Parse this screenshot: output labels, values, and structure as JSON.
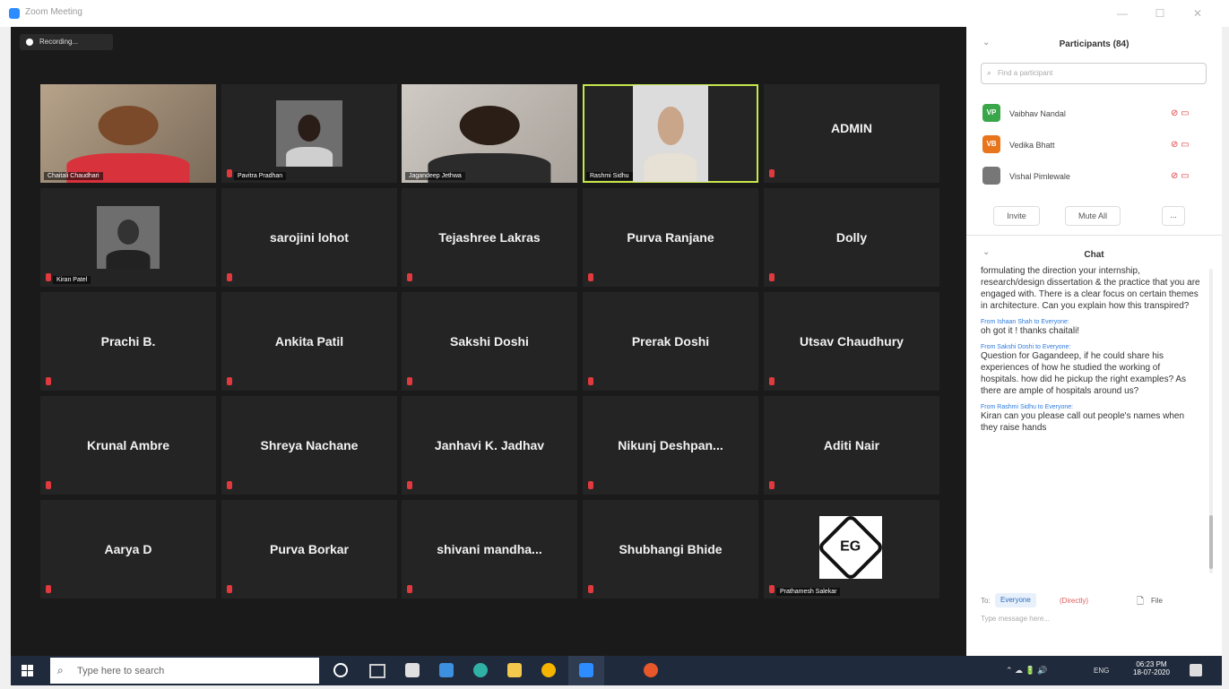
{
  "window": {
    "title": "Zoom Meeting",
    "minimize": "—",
    "maximize": "☐",
    "close": "✕"
  },
  "recording": {
    "label": "Recording..."
  },
  "tiles": [
    {
      "type": "video",
      "name": "Chaitali Chaudhari",
      "active": false
    },
    {
      "type": "video",
      "name": "Pavitra Pradhan",
      "active": false
    },
    {
      "type": "video",
      "name": "Jagandeep Jethwa",
      "active": false
    },
    {
      "type": "video",
      "name": "Rashmi Sidhu",
      "active": true
    },
    {
      "type": "name",
      "name": "ADMIN"
    },
    {
      "type": "video",
      "name": "Kiran Patel",
      "active": false
    },
    {
      "type": "name",
      "name": "sarojini lohot"
    },
    {
      "type": "name",
      "name": "Tejashree Lakras"
    },
    {
      "type": "name",
      "name": "Purva Ranjane"
    },
    {
      "type": "name",
      "name": "Dolly"
    },
    {
      "type": "name",
      "name": "Prachi B."
    },
    {
      "type": "name",
      "name": "Ankita Patil"
    },
    {
      "type": "name",
      "name": "Sakshi Doshi"
    },
    {
      "type": "name",
      "name": "Prerak Doshi"
    },
    {
      "type": "name",
      "name": "Utsav Chaudhury"
    },
    {
      "type": "name",
      "name": "Krunal Ambre"
    },
    {
      "type": "name",
      "name": "Shreya Nachane"
    },
    {
      "type": "name",
      "name": "Janhavi K. Jadhav"
    },
    {
      "type": "name",
      "name": "Nikunj  Deshpan..."
    },
    {
      "type": "name",
      "name": "Aditi Nair"
    },
    {
      "type": "name",
      "name": "Aarya D"
    },
    {
      "type": "name",
      "name": "Purva Borkar"
    },
    {
      "type": "name",
      "name": "shivani  mandha..."
    },
    {
      "type": "name",
      "name": "Shubhangi Bhide"
    },
    {
      "type": "logo",
      "name": "Prathamesh Salekar",
      "logo_text": "EG"
    }
  ],
  "participants": {
    "header": "Participants (84)",
    "search_placeholder": "Find a participant",
    "items": [
      {
        "initials": "VP",
        "name": "Vaibhav Nandal",
        "color": "#3aa64a"
      },
      {
        "initials": "VB",
        "name": "Vedika Bhatt",
        "color": "#e8741c"
      },
      {
        "initials": "",
        "name": "Vishal Pimlewale",
        "color": "#777777"
      }
    ],
    "invite_label": "Invite",
    "mute_all_label": "Mute All",
    "more_label": "..."
  },
  "chat": {
    "header": "Chat",
    "messages": [
      {
        "sender": "",
        "text": "formulating the direction your internship, research/design dissertation & the practice that you are engaged with. There is a clear focus on certain themes in architecture. Can you explain how this transpired?"
      },
      {
        "sender": "From Ishaan Shah to Everyone:",
        "text": "oh got it ! thanks chaitali!"
      },
      {
        "sender": "From Sakshi Doshi to Everyone:",
        "text": "Question for Gagandeep, if he could share his experiences of how he studied the working of hospitals. how did he pickup the right examples? As there are ample of hospitals around us?"
      },
      {
        "sender": "From Rashmi Sidhu to Everyone:",
        "text": "Kiran can you please call out people's names when they raise hands"
      }
    ],
    "to_label": "To:",
    "to_value": "Everyone",
    "privately": "(Directly)",
    "file_label": "File",
    "input_placeholder": "Type message here..."
  },
  "taskbar": {
    "search_placeholder": "Type here to search",
    "time": "06:23 PM",
    "date": "18-07-2020",
    "lang": "ENG"
  }
}
